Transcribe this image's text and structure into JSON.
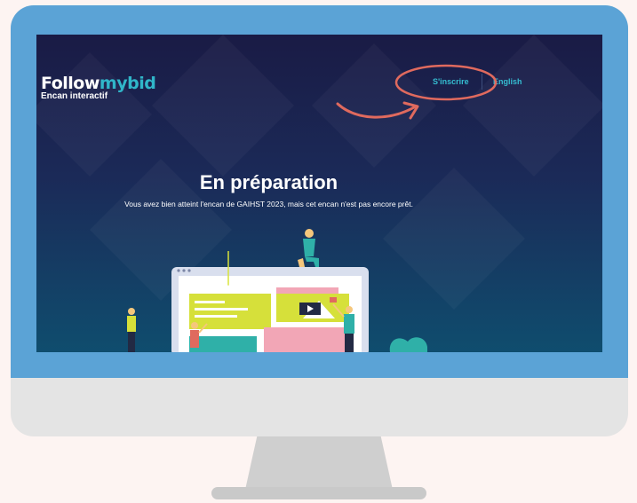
{
  "header": {
    "logo": {
      "word_main": "Follow",
      "word_accent": "mybid",
      "tagline": "Encan interactif"
    },
    "nav": {
      "register_label": "S'inscrire",
      "language_label": "English"
    }
  },
  "main": {
    "title": "En préparation",
    "message": "Vous avez bien atteint l'encan de GAIHST 2023, mais cet encan n'est pas encore prêt."
  },
  "colors": {
    "bezel": "#5ba3d6",
    "accent": "#30b6c9",
    "annotation": "#e06a5e",
    "background_top": "#1a1b45",
    "background_bottom": "#0f4d6e"
  }
}
